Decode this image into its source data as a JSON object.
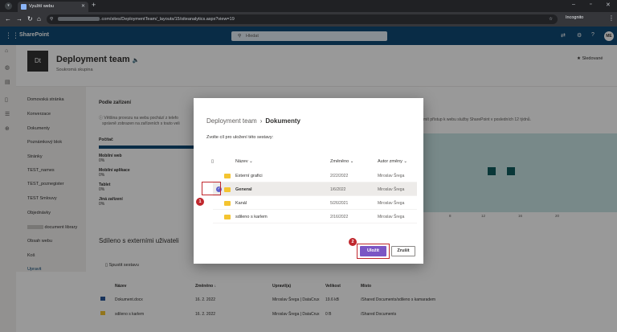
{
  "browser": {
    "tab_title": "Využití webu",
    "new_tab": "+",
    "url_prefix": "",
    "url_path": ".com/sites/DeploymentTeam/_layouts/15/siteanalytics.aspx?view=19",
    "incognito_label": "Incognito"
  },
  "suite": {
    "app_name": "SharePoint",
    "search_placeholder": "Hledat",
    "user_initials": "ME"
  },
  "site": {
    "logo_text": "Dt",
    "name": "Deployment team",
    "subtitle": "Soukromá skupina",
    "follow_label": "Sledované"
  },
  "nav": {
    "items": [
      "Domovská stránka",
      "Konverzace",
      "Dokumenty",
      "Poznámkový blok",
      "Stránky",
      "TEST_names",
      "TEST_poznegister",
      "TEST Smlouvy",
      "Objednávky",
      "document library",
      "Obsah webu",
      "Koš",
      "Upravit"
    ]
  },
  "main": {
    "devices_heading": "Podle zařízení",
    "devices_info_1": "Většina provozu na webu pochází z telefo",
    "devices_info_2": "správně zobrazen na zařízeních s touto veli",
    "right_info": "mít přístup k webu služby SharePoint v posledních 12 týdnů.",
    "stats": [
      {
        "label": "Počítač",
        "value": ""
      },
      {
        "label": "Mobilní web",
        "value": "0%"
      },
      {
        "label": "Mobilní aplikace",
        "value": "0%"
      },
      {
        "label": "Tablet",
        "value": "0%"
      },
      {
        "label": "Jiná zařízení",
        "value": "0%"
      }
    ],
    "chart_ticks": [
      "8",
      "12",
      "16",
      "20"
    ],
    "share_heading": "Sdíleno s externími uživateli",
    "start_report": "Spustit sestavu",
    "table_headers": [
      "Název",
      "Změněno ↓",
      "Upravil(a)",
      "Velikost",
      "Místo"
    ],
    "table_rows": [
      [
        "Dokument.docx",
        "16. 2. 2022",
        "Miroslav Šrega | DataCrux",
        "19.6 kB",
        "/Shared Documents/sdileno s kamaradem"
      ],
      [
        "sdileno s karlem",
        "16. 2. 2022",
        "Miroslav Šrega | DataCrux",
        "0 B",
        "/Shared Documents"
      ]
    ]
  },
  "dialog": {
    "crumb_root": "Deployment team",
    "crumb_sep": "›",
    "crumb_current": "Dokumenty",
    "prompt": "Zvolte cíl pro uložení této sestavy:",
    "col_name": "Název",
    "col_modified": "Změněno",
    "col_author": "Autor změny",
    "rows": [
      {
        "name": "Externí grafici",
        "modified": "2/22/2022",
        "author": "Miroslav Šrega"
      },
      {
        "name": "General",
        "modified": "1/6/2022",
        "author": "Miroslav Šrega"
      },
      {
        "name": "Kanál",
        "modified": "5/26/2021",
        "author": "Miroslav Šrega"
      },
      {
        "name": "sdileno s karlem",
        "modified": "2/16/2022",
        "author": "Miroslav Šrega"
      }
    ],
    "save_label": "Uložit",
    "cancel_label": "Zrušit",
    "step1": "1",
    "step2": "2"
  },
  "colors": {
    "suite_bar": "#0f4a75",
    "accent_purple": "#7b56c4",
    "highlight_red": "#c0272d",
    "chart_teal": "#0f5d5e"
  }
}
